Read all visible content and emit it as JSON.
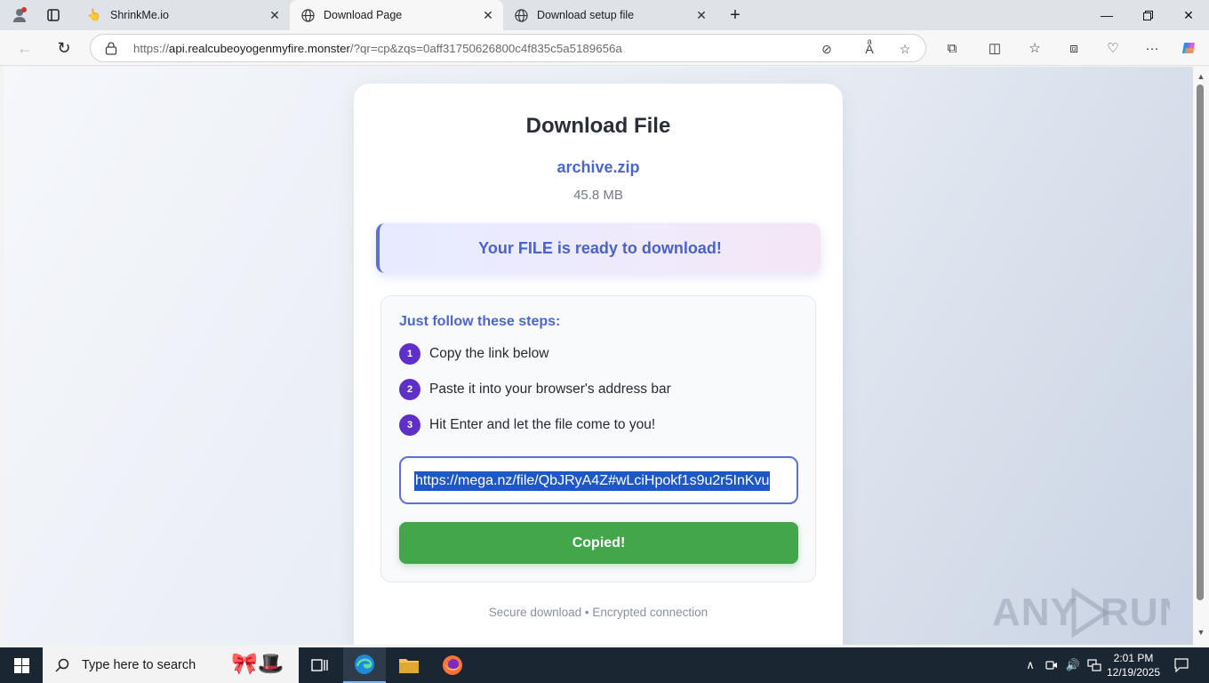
{
  "browser": {
    "tabs": [
      {
        "title": "ShrinkMe.io",
        "icon": "shrinkme-hand-icon"
      },
      {
        "title": "Download Page",
        "icon": "globe-icon"
      },
      {
        "title": "Download setup file",
        "icon": "globe-icon"
      }
    ],
    "url_host": "api.realcubeoyogenmyfire.monster",
    "url_prefix": "https://",
    "url_path": "/?qr=cp&zqs=0aff31750626800c4f835c5a5189656a"
  },
  "page": {
    "title": "Download File",
    "file_name": "archive.zip",
    "file_size": "45.8 MB",
    "ready_message": "Your FILE is ready to download!",
    "steps_title": "Just follow these steps:",
    "steps": [
      {
        "num": "1",
        "text": "Copy the link below"
      },
      {
        "num": "2",
        "text": "Paste it into your browser's address bar"
      },
      {
        "num": "3",
        "text": "Hit Enter and let the file come to you!"
      }
    ],
    "link_value": "https://mega.nz/file/QbJRyA4Z#wLciHpokf1s9u2r5InKvu",
    "copy_button": "Copied!",
    "footer": "Secure download • Encrypted connection"
  },
  "watermark": "ANY RUN",
  "taskbar": {
    "search_placeholder": "Type here to search",
    "time": "2:01 PM",
    "date": "12/19/2025"
  },
  "colors": {
    "accent": "#4a67cc",
    "step_badge": "#5e2fc9",
    "copy_button": "#43a64a",
    "selection": "#1f56c8"
  }
}
